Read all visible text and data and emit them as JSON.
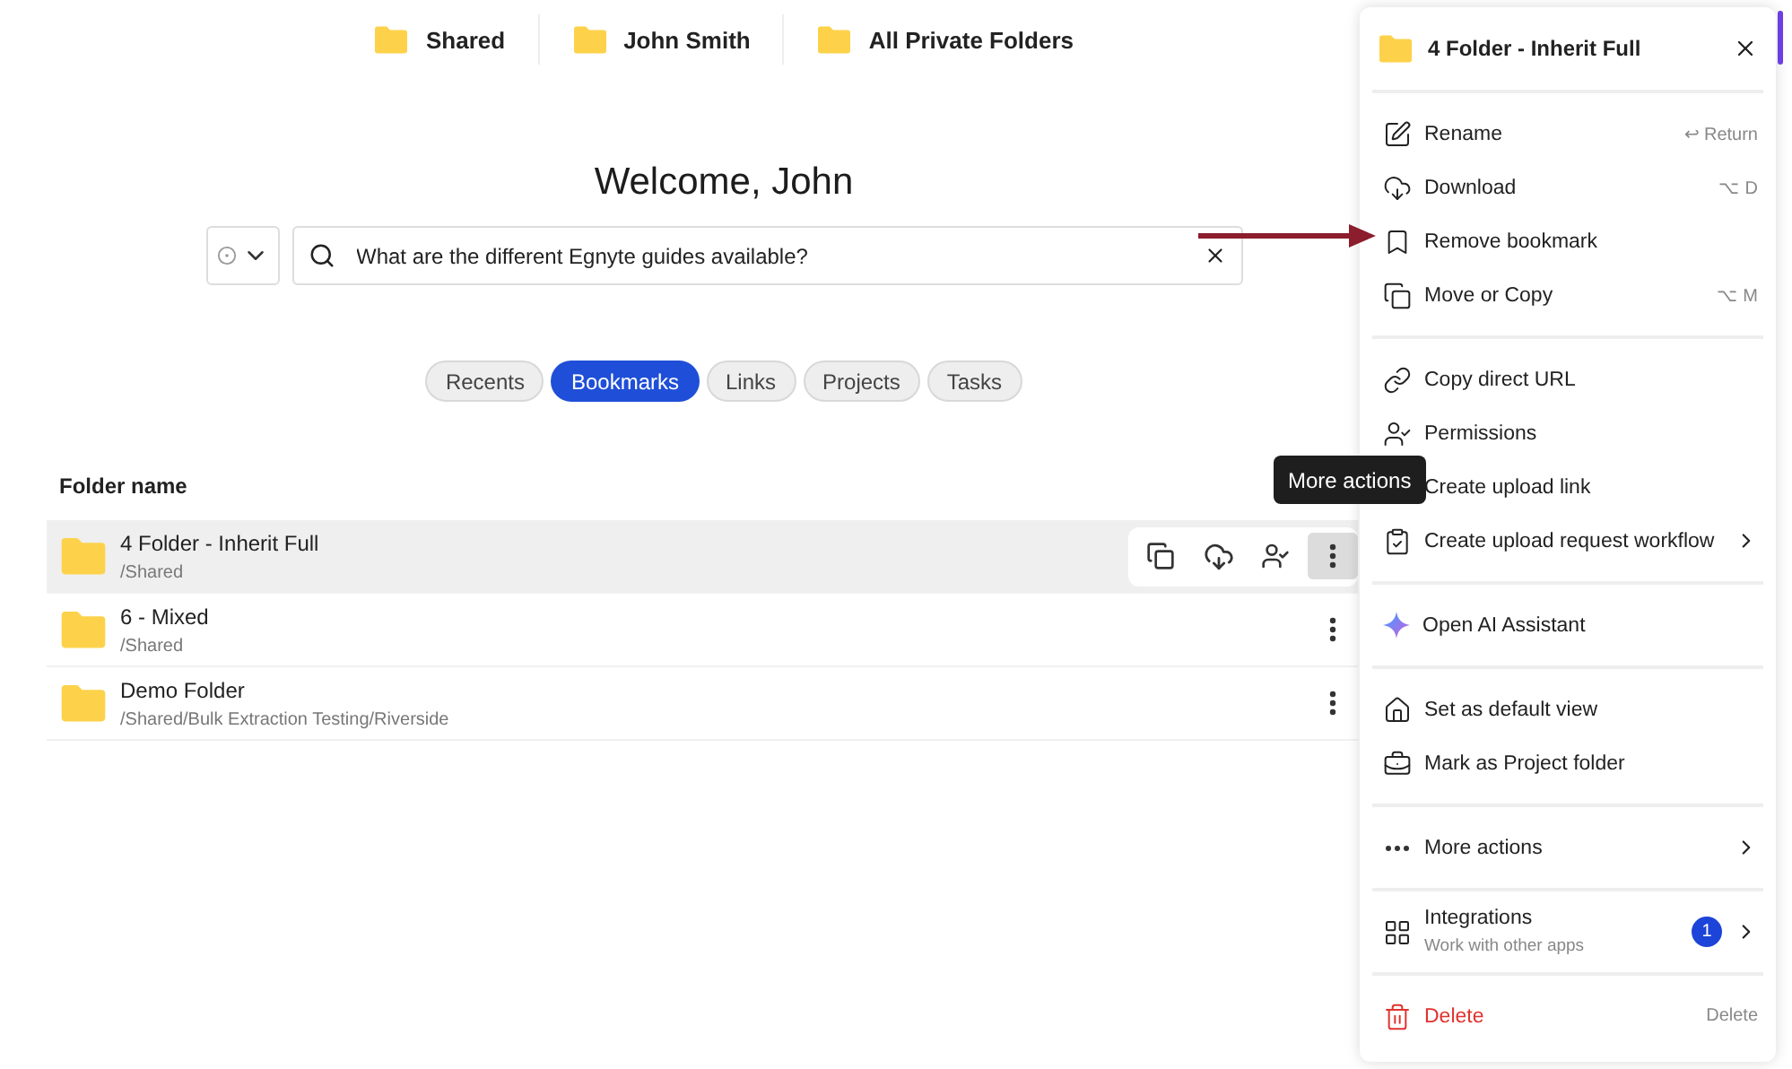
{
  "shortcuts": [
    {
      "label": "Shared"
    },
    {
      "label": "John Smith"
    },
    {
      "label": "All Private Folders"
    }
  ],
  "welcome": "Welcome, John",
  "search": {
    "value": "What are the different Egnyte guides available?"
  },
  "tabs": [
    {
      "label": "Recents",
      "selected": false
    },
    {
      "label": "Bookmarks",
      "selected": true
    },
    {
      "label": "Links",
      "selected": false
    },
    {
      "label": "Projects",
      "selected": false
    },
    {
      "label": "Tasks",
      "selected": false
    }
  ],
  "table": {
    "columns": [
      "Folder name"
    ],
    "rows": [
      {
        "name": "4 Folder - Inherit Full",
        "path": "/Shared",
        "selected": true
      },
      {
        "name": "6 - Mixed",
        "path": "/Shared",
        "selected": false
      },
      {
        "name": "Demo Folder",
        "path": "/Shared/Bulk Extraction Testing/Riverside",
        "selected": false
      }
    ]
  },
  "tooltip": "More actions",
  "menu": {
    "title": "4 Folder - Inherit Full",
    "groups": [
      [
        {
          "label": "Rename",
          "shortcut": "↩ Return"
        },
        {
          "label": "Download",
          "shortcut": "⌥ D"
        },
        {
          "label": "Remove bookmark"
        },
        {
          "label": "Move or Copy",
          "shortcut": "⌥ M"
        }
      ],
      [
        {
          "label": "Copy direct URL"
        },
        {
          "label": "Permissions"
        },
        {
          "label": "Create upload link"
        },
        {
          "label": "Create upload request workflow",
          "submenu": true
        }
      ],
      [
        {
          "label": "Open AI Assistant"
        }
      ],
      [
        {
          "label": "Set as default view"
        },
        {
          "label": "Mark as Project folder"
        }
      ],
      [
        {
          "label": "More actions",
          "submenu": true
        }
      ],
      [
        {
          "label": "Integrations",
          "subtitle": "Work with other apps",
          "badge": "1",
          "submenu": true
        }
      ],
      [
        {
          "label": "Delete",
          "shortcut": "Delete",
          "kind": "danger"
        }
      ]
    ]
  }
}
